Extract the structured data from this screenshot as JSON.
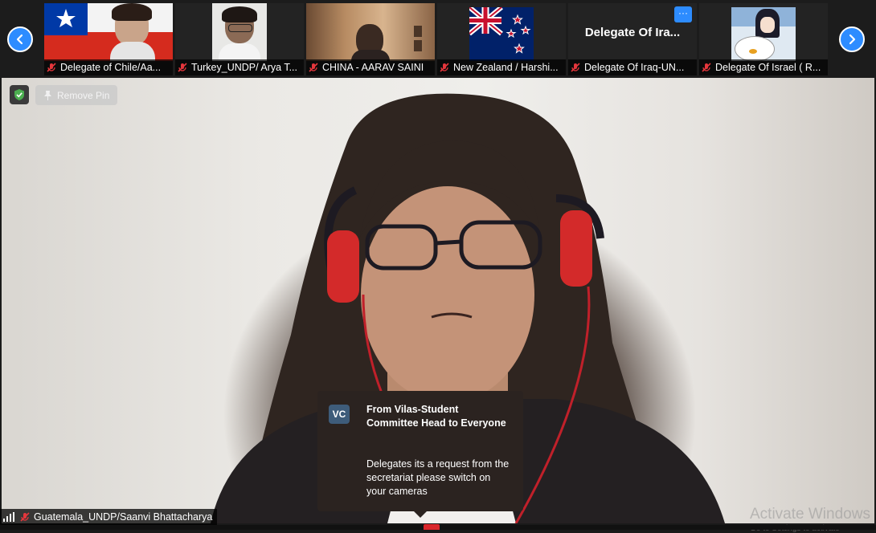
{
  "filmstrip": {
    "prev_label": "",
    "next_label": "",
    "participants": [
      {
        "name": "Delegate of Chile/Aa..."
      },
      {
        "name": "Turkey_UNDP/ Arya T..."
      },
      {
        "name": "CHINA - AARAV SAINI"
      },
      {
        "name": "New Zealand / Harshi..."
      },
      {
        "name": "Delegate Of Iraq-UN...",
        "tile_text": "Delegate Of Ira...",
        "more_label": "···"
      },
      {
        "name": "Delegate Of Israel ( R..."
      }
    ]
  },
  "main_video": {
    "remove_pin_label": "Remove Pin",
    "speaker_name": "Guatemala_UNDP/Saanvi Bhattacharya"
  },
  "chat_popup": {
    "avatar_initials": "VC",
    "title": "From Vilas-Student Committee Head to Everyone",
    "message": "Delegates its a request from the secretariat please switch on your cameras"
  },
  "watermark": {
    "line1": "Activate Windows",
    "line2": "Go to Settings to activate"
  },
  "colors": {
    "accent": "#2d8cff",
    "mic_off": "#e5363c",
    "chat_bg": "#2b2320",
    "avatar_bg": "#3e5c7a",
    "shield": "#4caf50"
  }
}
